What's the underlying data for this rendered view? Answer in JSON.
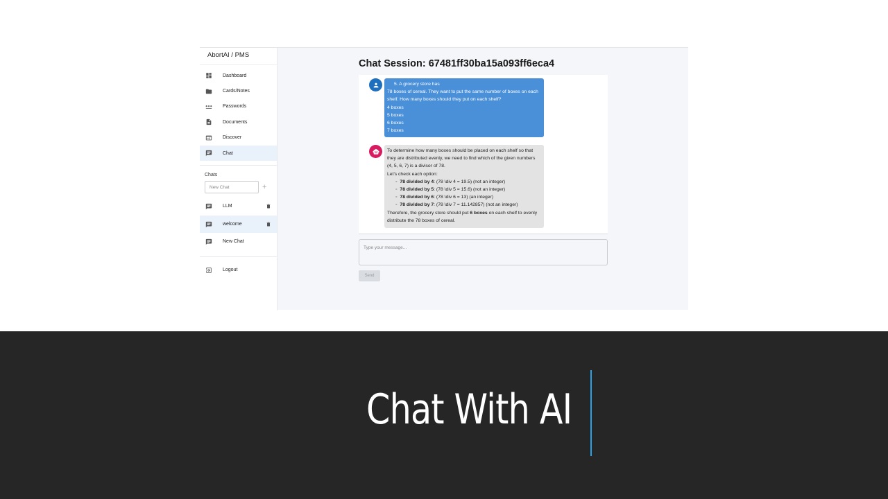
{
  "app": {
    "brand": "AbortAI / PMS",
    "nav": [
      {
        "label": "Dashboard",
        "icon": "dashboard-icon"
      },
      {
        "label": "Cards/Notes",
        "icon": "cards-icon"
      },
      {
        "label": "Passwords",
        "icon": "password-icon"
      },
      {
        "label": "Documents",
        "icon": "document-icon"
      },
      {
        "label": "Discover",
        "icon": "discover-icon"
      },
      {
        "label": "Chat",
        "icon": "chat-icon",
        "active": true
      }
    ],
    "chats_heading": "Chats",
    "new_chat_placeholder": "New Chat",
    "chat_list": [
      {
        "label": "LLM"
      },
      {
        "label": "welcome",
        "active": true
      },
      {
        "label": "New Chat"
      }
    ],
    "logout": "Logout"
  },
  "session": {
    "title": "Chat Session: 67481ff30ba15a093ff6eca4",
    "user_message": {
      "line1": "5. A grocery store has",
      "line2": "78 boxes of cereal. They want to put the same number of boxes on each shelf. How many boxes should they put on each shelf?",
      "options": [
        "4 boxes",
        "5 boxes",
        "6 boxes",
        "7 boxes"
      ]
    },
    "bot_message": {
      "intro": "To determine how many boxes should be placed on each shelf so that they are distributed evenly, we need to find which of the given numbers (4, 5, 6, 7) is a divisor of 78.",
      "check": "Let's check each option:",
      "items": [
        {
          "bold": "78 divided by 4",
          "rest": ": (78 \\div 4 = 19.5) (not an integer)"
        },
        {
          "bold": "78 divided by 5",
          "rest": ": (78 \\div 5 = 15.6) (not an integer)"
        },
        {
          "bold": "78 divided by 6",
          "rest": ": (78 \\div 6 = 13) (an integer)"
        },
        {
          "bold": "78 divided by 7",
          "rest": ": (78 \\div 7 = 11.142857) (not an integer)"
        }
      ],
      "conclusion_pre": "Therefore, the grocery store should put ",
      "conclusion_bold": "6 boxes",
      "conclusion_post": " on each shelf to evenly distribute the 78 boxes of cereal."
    },
    "input_placeholder": "Type your message...",
    "send_label": "Send"
  },
  "slide": {
    "title": "Chat With AI",
    "accent_color": "#2aa4e8",
    "band_color": "#262626"
  }
}
